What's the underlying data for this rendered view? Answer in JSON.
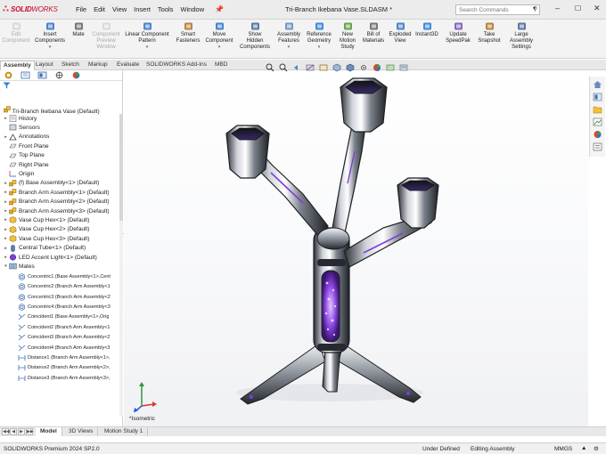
{
  "app": {
    "logo_mark": "∴",
    "logo_bold": "SOLID",
    "logo_light": "WORKS"
  },
  "menu": [
    "File",
    "Edit",
    "View",
    "Insert",
    "Tools",
    "Window"
  ],
  "document_title": "Tri-Branch Ikebana Vase.SLDASM *",
  "search": {
    "placeholder": "Search Commands"
  },
  "ribbon": [
    {
      "label": "Edit\nComponent",
      "icon": "edit-component-icon",
      "disabled": true
    },
    {
      "label": "Insert\nComponents",
      "icon": "insert-components-icon",
      "disabled": false
    },
    {
      "label": "Mate",
      "icon": "mate-icon",
      "disabled": false
    },
    {
      "label": "Component\nPreview\nWindow",
      "icon": "component-preview-icon",
      "disabled": true
    },
    {
      "label": "Linear Component\nPattern",
      "icon": "linear-pattern-icon",
      "disabled": false
    },
    {
      "label": "Smart\nFasteners",
      "icon": "smart-fasteners-icon",
      "disabled": false
    },
    {
      "label": "Move\nComponent",
      "icon": "move-component-icon",
      "disabled": false
    },
    {
      "label": "Show\nHidden\nComponents",
      "icon": "show-hidden-icon",
      "disabled": false
    },
    {
      "label": "Assembly\nFeatures",
      "icon": "assembly-features-icon",
      "disabled": false
    },
    {
      "label": "Reference\nGeometry",
      "icon": "reference-geometry-icon",
      "disabled": false
    },
    {
      "label": "New\nMotion\nStudy",
      "icon": "motion-study-icon",
      "disabled": false
    },
    {
      "label": "Bill of\nMaterials",
      "icon": "bom-icon",
      "disabled": false
    },
    {
      "label": "Exploded\nView",
      "icon": "exploded-view-icon",
      "disabled": false
    },
    {
      "label": "Instant3D",
      "icon": "instant3d-icon",
      "disabled": false
    },
    {
      "label": "Update\nSpeedPak",
      "icon": "speedpak-icon",
      "disabled": false
    },
    {
      "label": "Take\nSnapshot",
      "icon": "snapshot-icon",
      "disabled": false
    },
    {
      "label": "Large\nAssembly\nSettings",
      "icon": "large-assembly-icon",
      "disabled": false
    }
  ],
  "command_tabs": [
    "Assembly",
    "Layout",
    "Sketch",
    "Markup",
    "Evaluate",
    "SOLIDWORKS Add-Ins",
    "MBD"
  ],
  "tree": {
    "root": "Tri-Branch Ikebana Vase  (Default)",
    "items": [
      {
        "label": "History",
        "icon": "history-icon",
        "expand": "▸",
        "indent": 0
      },
      {
        "label": "Sensors",
        "icon": "sensors-icon",
        "expand": "",
        "indent": 0
      },
      {
        "label": "Annotations",
        "icon": "annotations-icon",
        "expand": "▸",
        "indent": 0
      },
      {
        "label": "Front Plane",
        "icon": "plane-icon",
        "expand": "",
        "indent": 0
      },
      {
        "label": "Top Plane",
        "icon": "plane-icon",
        "expand": "",
        "indent": 0
      },
      {
        "label": "Right Plane",
        "icon": "plane-icon",
        "expand": "",
        "indent": 0
      },
      {
        "label": "Origin",
        "icon": "origin-icon",
        "expand": "",
        "indent": 0
      },
      {
        "label": "(f) Base Assembly<1> (Default)",
        "icon": "subassembly-icon",
        "expand": "▸",
        "indent": 0
      },
      {
        "label": "Branch Arm Assembly<1> (Default)",
        "icon": "subassembly-icon",
        "expand": "▸",
        "indent": 0
      },
      {
        "label": "Branch Arm Assembly<2> (Default)",
        "icon": "subassembly-icon",
        "expand": "▸",
        "indent": 0
      },
      {
        "label": "Branch Arm Assembly<3> (Default)",
        "icon": "subassembly-icon",
        "expand": "▸",
        "indent": 0
      },
      {
        "label": "Vase Cup Hex<1> (Default)",
        "icon": "part-icon",
        "expand": "▸",
        "indent": 0
      },
      {
        "label": "Vase Cup Hex<2> (Default)",
        "icon": "part-icon",
        "expand": "▸",
        "indent": 0
      },
      {
        "label": "Vase Cup Hex<3> (Default)",
        "icon": "part-icon",
        "expand": "▸",
        "indent": 0
      },
      {
        "label": "Central Tube<1> (Default)",
        "icon": "tube-icon",
        "expand": "▸",
        "indent": 0
      },
      {
        "label": "LED Accent Light<1> (Default)",
        "icon": "led-icon",
        "expand": "▸",
        "indent": 0
      },
      {
        "label": "Mates",
        "icon": "mates-icon",
        "expand": "▾",
        "indent": 0
      }
    ],
    "mates": [
      {
        "label": "Concentric1 (Base Assembly<1>,Cent",
        "icon": "concentric-icon"
      },
      {
        "label": "Concentric2 (Branch Arm Assembly<1",
        "icon": "concentric-icon"
      },
      {
        "label": "Concentric3 (Branch Arm Assembly<2",
        "icon": "concentric-icon"
      },
      {
        "label": "Concentric4 (Branch Arm Assembly<3",
        "icon": "concentric-icon"
      },
      {
        "label": "Coincident1 (Base Assembly<1>,Orig",
        "icon": "coincident-icon"
      },
      {
        "label": "Coincident2 (Branch Arm Assembly<1",
        "icon": "coincident-icon"
      },
      {
        "label": "Coincident3 (Branch Arm Assembly<2",
        "icon": "coincident-icon"
      },
      {
        "label": "Coincident4 (Branch Arm Assembly<3",
        "icon": "coincident-icon"
      },
      {
        "label": "Distance1 (Branch Arm Assembly<1>,",
        "icon": "distance-icon"
      },
      {
        "label": "Distance2 (Branch Arm Assembly<2>,",
        "icon": "distance-icon"
      },
      {
        "label": "Distance3 (Branch Arm Assembly<3>,",
        "icon": "distance-icon"
      }
    ]
  },
  "viewport": {
    "view_name": "*Isometric"
  },
  "bottom_tabs": [
    "Model",
    "3D Views",
    "Motion Study 1"
  ],
  "status": {
    "version": "SOLIDWORKS Premium 2024 SP2.0",
    "definition": "Under Defined",
    "mode": "Editing Assembly",
    "units": "MMGS"
  },
  "colors": {
    "brand": "#c8102e",
    "led": "#7b3fd6",
    "chrome_dark": "#2a2d33"
  }
}
